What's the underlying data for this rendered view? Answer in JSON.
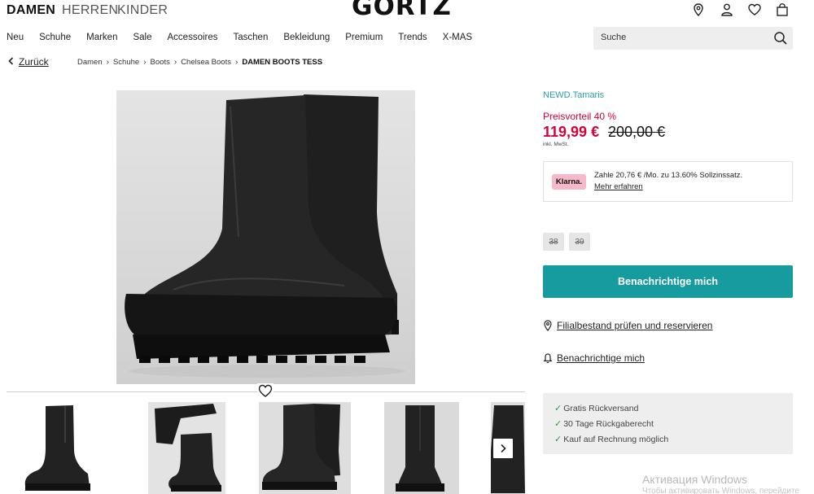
{
  "header": {
    "genders": [
      "DAMEN",
      "HERREN",
      "KINDER"
    ],
    "logo": "GÖRTZ",
    "icons": [
      "location-pin-icon",
      "user-icon",
      "heart-icon",
      "shopping-bag-icon"
    ]
  },
  "nav": {
    "items": [
      "Neu",
      "Schuhe",
      "Marken",
      "Sale",
      "Accessoires",
      "Taschen",
      "Bekleidung",
      "Premium",
      "Trends",
      "X-MAS"
    ]
  },
  "search": {
    "placeholder": "Suche"
  },
  "breadcrumb": {
    "back": "Zurück",
    "items": [
      "Damen",
      "Schuhe",
      "Boots",
      "Chelsea Boots"
    ],
    "current": "DAMEN BOOTS TESS"
  },
  "product": {
    "brand": "NEWD.Tamaris",
    "saving": "Preisvorteil 40 %",
    "price": "119,99 €",
    "old_price": "200,00 €",
    "vat": "inkl. MwSt.",
    "klarna_logo": "Klarna.",
    "klarna_text": "Zahle 20,76 € /Mo. zu 13.60% Sollzinssatz.",
    "klarna_link": "Mehr erfahren",
    "sizes": [
      "38",
      "39"
    ],
    "notify_button": "Benachrichtige mich",
    "store_link": "Filialbestand prüfen und reservieren",
    "notify_link": "Benachrichtige mich",
    "usps": [
      "Gratis Rückversand",
      "30 Tage Rückgaberecht",
      "Kauf auf Rechnung möglich"
    ]
  },
  "watermark": {
    "title": "Активация Windows",
    "subtitle": "Чтобы активировать Windows, перейдите"
  },
  "colors": {
    "accent": "#169b9f",
    "sale": "#d4003a",
    "brand_link": "#2a9da3",
    "klarna_pink": "#f6b9c9"
  }
}
